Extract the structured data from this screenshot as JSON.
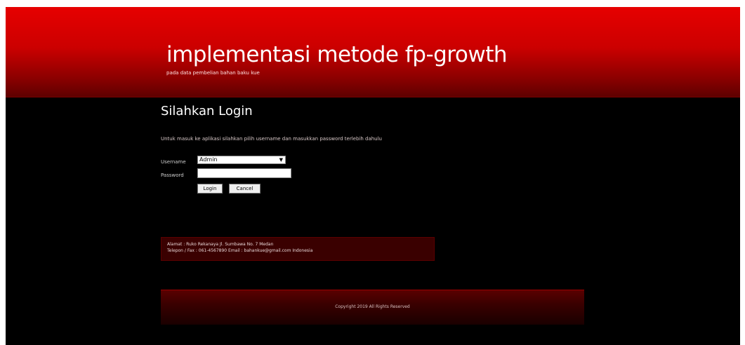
{
  "header": {
    "title": "implementasi metode fp-growth",
    "subtitle": "pada data pembelian bahan baku kue"
  },
  "login": {
    "heading": "Silahkan Login",
    "intro": "Untuk masuk ke aplikasi silahkan pilih username dan masukkan password terlebih dahulu",
    "username_label": "Username",
    "username_selected": "Admin",
    "password_label": "Password",
    "login_button": "Login",
    "cancel_button": "Cancel"
  },
  "info": {
    "line1": "Alamat : Ruko Rekanaya Jl. Sumbawa No. 7 Medan",
    "line2": "Telepon / Fax : 061-4567890 Email : bahankue@gmail.com Indonesia"
  },
  "footer": {
    "text": "Copyright 2019 All Rights Reserved"
  }
}
